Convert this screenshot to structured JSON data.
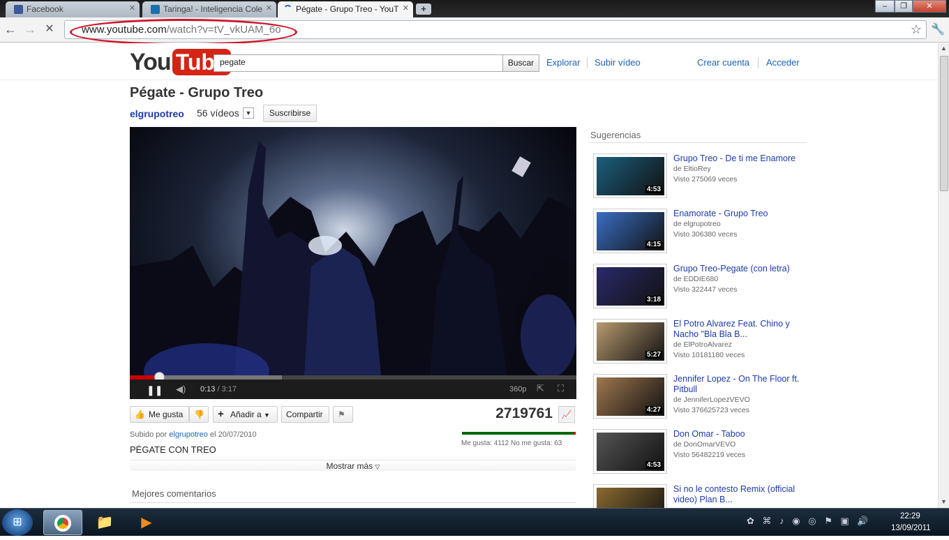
{
  "browser": {
    "tabs": [
      {
        "title": "Facebook",
        "favicon_color": "#3b5998"
      },
      {
        "title": "Taringa! - Inteligencia Cole",
        "favicon_color": "#1c6fb0"
      },
      {
        "title": "Pégate - Grupo Treo - YouT",
        "favicon_color": "#c00"
      }
    ],
    "new_tab": "+",
    "url_main": "www.youtube.com",
    "url_rest": "/watch?v=tV_vkUAM_6o",
    "win_minimize": "–",
    "win_maximize": "❐",
    "win_close": "✕"
  },
  "youtube": {
    "logo_you": "You",
    "logo_tube": "Tube",
    "search_value": "pegate",
    "search_button": "Buscar",
    "nav": [
      "Explorar",
      "Subir vídeo",
      "Crear cuenta",
      "Acceder"
    ],
    "video": {
      "title": "Pégate - Grupo Treo",
      "channel": "elgrupotreo",
      "video_count": "56 vídeos",
      "subscribe": "Suscribirse",
      "time_current": "0:13",
      "time_total": " / 3:17",
      "quality": "360p",
      "progress_played": 0.066,
      "progress_loaded": 0.34
    },
    "actions": {
      "like": "Me gusta",
      "add_to": "Añadir a",
      "share": "Compartir",
      "views": "2719761",
      "likes_text": "Me gusta: 4112 No me gusta: 63"
    },
    "uploaded_prefix": "Subido por ",
    "uploaded_user": "elgrupotreo",
    "uploaded_date": " el 20/07/2010",
    "description": "PÉGATE CON TREO",
    "show_more": "Mostrar más",
    "comments_heading": "Mejores comentarios",
    "suggestions_heading": "Sugerencias",
    "suggestions": [
      {
        "title": "Grupo Treo - De ti me Enamore",
        "by": "de EltioRey",
        "views": "Visto 275069 veces",
        "duration": "4:53",
        "tint": "#1b5f7e"
      },
      {
        "title": "Enamorate - Grupo Treo",
        "by": "de elgrupotreo",
        "views": "Visto 306380 veces",
        "duration": "4:15",
        "tint": "#3a6fc4"
      },
      {
        "title": "Grupo Treo-Pegate (con letra)",
        "by": "de EDDIE680",
        "views": "Visto 322447 veces",
        "duration": "3:18",
        "tint": "#2a2a6a"
      },
      {
        "title": "El Potro Alvarez Feat. Chino y Nacho \"Bla Bla B...",
        "by": "de ElPotroAlvarez",
        "views": "Visto 10181180 veces",
        "duration": "5:27",
        "tint": "#b89a70"
      },
      {
        "title": "Jennifer Lopez - On The Floor ft. Pitbull",
        "by": "de JenniferLopezVEVO",
        "views": "Visto 376625723 veces",
        "duration": "4:27",
        "tint": "#a07850"
      },
      {
        "title": "Don Omar - Taboo",
        "by": "de DonOmarVEVO",
        "views": "Visto 56482219 veces",
        "duration": "4:53",
        "tint": "#555"
      },
      {
        "title": "Si no le contesto Remix (official video) Plan B...",
        "by": "",
        "views": "",
        "duration": "",
        "tint": "#8a6a30"
      }
    ]
  },
  "taskbar": {
    "time": "22:29",
    "date": "13/09/2011"
  }
}
